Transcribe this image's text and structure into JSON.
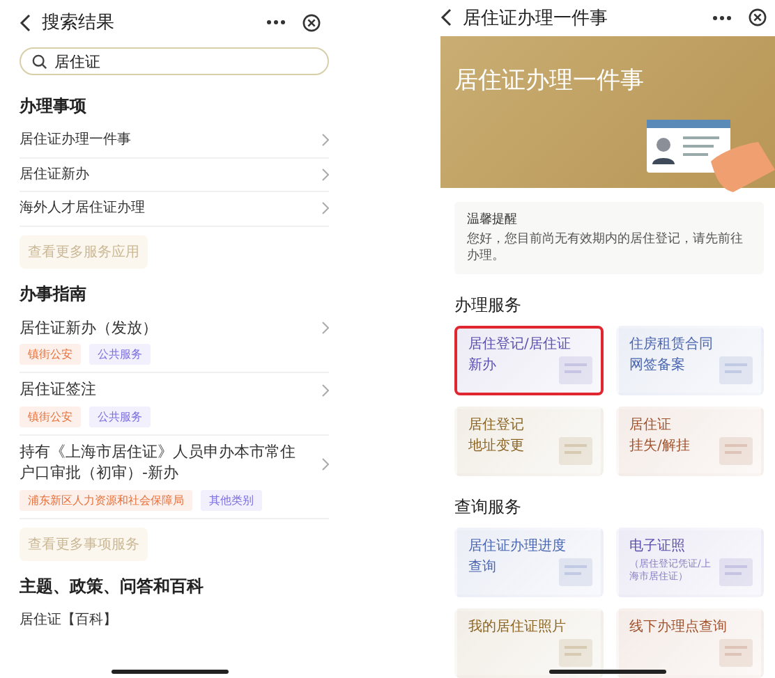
{
  "left_screen": {
    "title": "搜索结果",
    "search": {
      "value": "居住证"
    },
    "sections": [
      {
        "title": "办理事项",
        "items": [
          {
            "label": "居住证办理一件事"
          },
          {
            "label": "居住证新办"
          },
          {
            "label": "海外人才居住证办理"
          }
        ],
        "more_button": "查看更多服务应用"
      },
      {
        "title": "办事指南",
        "items": [
          {
            "label": "居住证新办（发放）",
            "tags": [
              {
                "text": "镇街公安",
                "color": "#e8703a"
              },
              {
                "text": "公共服务",
                "color": "#7a6ee0"
              }
            ]
          },
          {
            "label": "居住证签注",
            "tags": [
              {
                "text": "镇街公安",
                "color": "#e8703a"
              },
              {
                "text": "公共服务",
                "color": "#7a6ee0"
              }
            ]
          },
          {
            "label": "持有《上海市居住证》人员申办本市常住户口审批（初审）-新办",
            "tags": [
              {
                "text": "浦东新区人力资源和社会保障局",
                "color": "#e8703a"
              },
              {
                "text": "其他类别",
                "color": "#7a6ee0"
              }
            ]
          }
        ],
        "more_button": "查看更多事项服务"
      },
      {
        "title": "主题、政策、问答和百科",
        "items": [
          {
            "label": "居住证【百科】"
          }
        ]
      }
    ]
  },
  "right_screen": {
    "title": "居住证办理一件事",
    "banner_title": "居住证办理一件事",
    "notice": {
      "title": "温馨提醒",
      "text": "您好，您目前尚无有效期内的居住登记，请先前往办理。"
    },
    "sections": [
      {
        "title": "办理服务",
        "cards": [
          {
            "lines": [
              "居住登记/居住证",
              "新办"
            ],
            "color": "#5b4fae",
            "selected": true
          },
          {
            "lines": [
              "住房租赁合同",
              "网签备案"
            ],
            "color": "#4a66b0",
            "selected": false
          },
          {
            "lines": [
              "居住登记",
              "地址变更"
            ],
            "color": "#8a6422",
            "selected": false
          },
          {
            "lines": [
              "居住证",
              "挂失/解挂"
            ],
            "color": "#a0522d",
            "selected": false
          }
        ]
      },
      {
        "title": "查询服务",
        "cards": [
          {
            "lines": [
              "居住证办理进度",
              "查询"
            ],
            "color": "#4a66b0",
            "selected": false
          },
          {
            "lines": [
              "电子证照"
            ],
            "note": "（居住登记凭证/上海市居住证）",
            "color": "#5b4fae",
            "selected": false
          },
          {
            "lines": [
              "我的居住证照片"
            ],
            "color": "#8a6422",
            "selected": false
          },
          {
            "lines": [
              "线下办理点查询"
            ],
            "color": "#a0522d",
            "selected": false
          }
        ]
      }
    ]
  }
}
